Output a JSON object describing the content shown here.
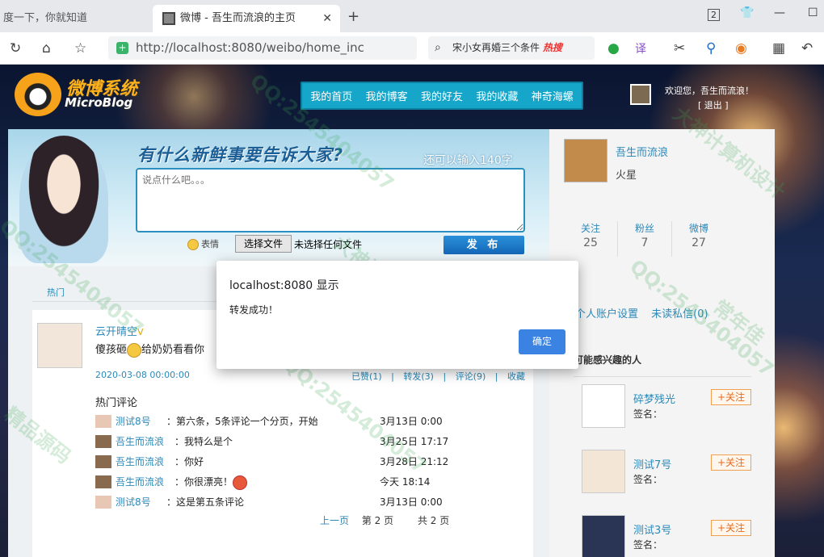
{
  "browser": {
    "tabs": [
      {
        "title": "度一下，你就知道",
        "active": false
      },
      {
        "title": "微博 - 吾生而流浪的主页",
        "active": true
      }
    ],
    "tab_count": "2",
    "url": "http://localhost:8080/weibo/home_inc",
    "search": {
      "text": "宋小女再婚三个条件",
      "hot_label": "热搜"
    }
  },
  "site": {
    "logo_title": "微博系统",
    "logo_subtitle": "MicroBlog",
    "nav": [
      "我的首页",
      "我的博客",
      "我的好友",
      "我的收藏",
      "神奇海螺"
    ],
    "welcome": "欢迎您，吾生而流浪！",
    "logout": "[ 退出 ]"
  },
  "composer": {
    "slogan": "有什么新鲜事要告诉大家?",
    "remaining": "还可以输入140字",
    "placeholder": "说点什么吧。。。",
    "emoticon_label": "表情",
    "choose_file": "选择文件",
    "no_file": "未选择任何文件",
    "post_button": "发 布"
  },
  "feed": {
    "tab": "热门",
    "post": {
      "author": "云开晴空",
      "vip": "V",
      "text_before": "傻孩砸",
      "text_after": "给奶奶看看你",
      "time": "2020-03-08 00:00:00",
      "actions": [
        "已赞(1)",
        "|",
        "转发(3)",
        "|",
        "评论(9)",
        "|",
        "收藏"
      ],
      "hot_comments_label": "热门评论",
      "comments": [
        {
          "user": "测试8号",
          "text": "：第六条，5条评论一个分页，开始",
          "time": "3月13日 0:00"
        },
        {
          "user": "吾生而流浪",
          "text": "：我特么是个",
          "time": "3月25日 17:17"
        },
        {
          "user": "吾生而流浪",
          "text": "：你好",
          "time": "3月28日 21:12"
        },
        {
          "user": "吾生而流浪",
          "text": "：你很漂亮！",
          "time": "今天 18:14"
        },
        {
          "user": "测试8号",
          "text": "：这是第五条评论",
          "time": "3月13日 0:00"
        }
      ],
      "pager": {
        "prev": "上一页",
        "current": "第 2 页",
        "total": "共 2 页"
      }
    }
  },
  "sidebar": {
    "username": "吾生而流浪",
    "location": "火星",
    "stats": [
      {
        "label": "关注",
        "value": "25"
      },
      {
        "label": "粉丝",
        "value": "7"
      },
      {
        "label": "微博",
        "value": "27"
      }
    ],
    "links": [
      "个人账户设置",
      "未读私信(0)"
    ],
    "maybe_title": "可能感兴趣的人",
    "recommendations": [
      {
        "name": "碎梦残光",
        "sign": "签名：",
        "follow": "+关注"
      },
      {
        "name": "测试7号",
        "sign": "签名：",
        "follow": "+关注"
      },
      {
        "name": "测试3号",
        "sign": "签名：",
        "follow": "+关注"
      }
    ]
  },
  "dialog": {
    "title": "localhost:8080 显示",
    "message": "转发成功！",
    "ok": "确定"
  },
  "watermarks": [
    "QQ:2545404057",
    "大神计算机设计",
    "精品源码",
    "常年佳"
  ]
}
